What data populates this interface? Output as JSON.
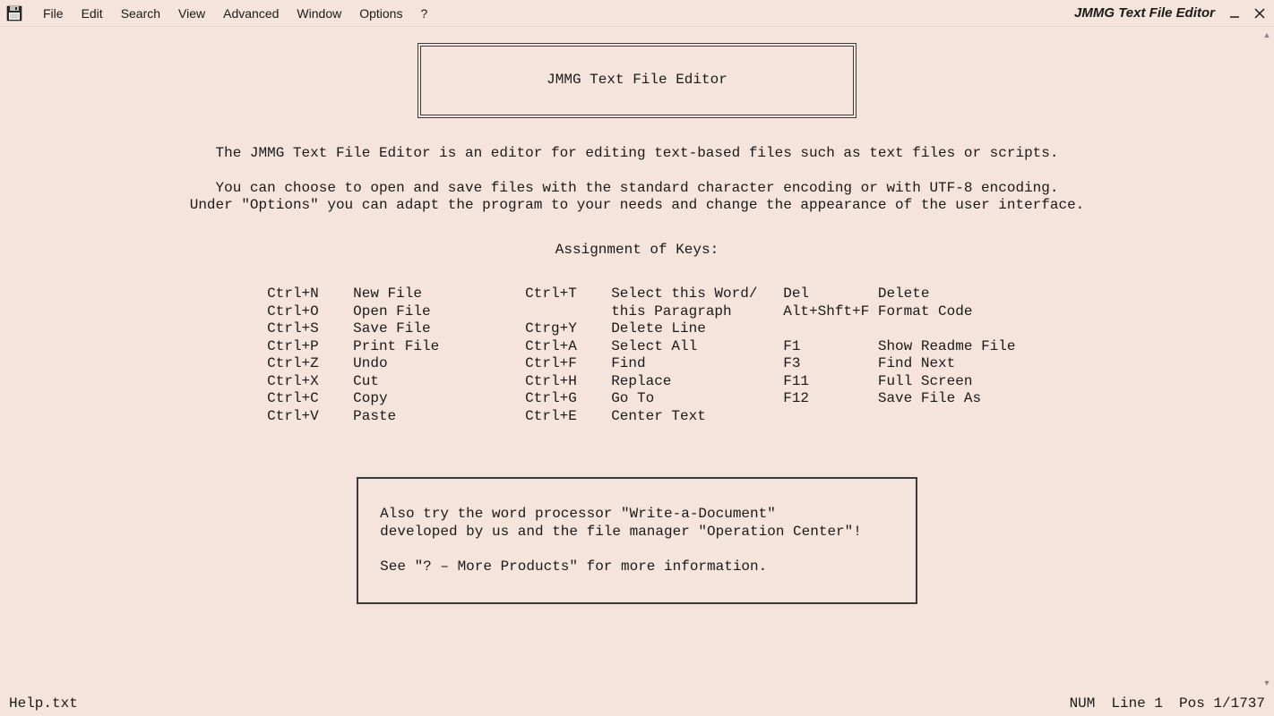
{
  "app": {
    "title": "JMMG Text File Editor"
  },
  "menu": {
    "file": "File",
    "edit": "Edit",
    "search": "Search",
    "view": "View",
    "advanced": "Advanced",
    "window": "Window",
    "options": "Options",
    "help": "?"
  },
  "document": {
    "title_box": "JMMG Text File Editor",
    "intro_line1": "The JMMG Text File Editor is an editor for editing text-based files such as text files or scripts.",
    "intro_line2": "You can choose to open and save files with the standard character encoding or with UTF-8 encoding.",
    "intro_line3": "Under \"Options\" you can adapt the program to your needs and change the appearance of the user interface.",
    "keys_heading": "Assignment of Keys:",
    "keys_block": " Ctrl+N    New File            Ctrl+T    Select this Word/   Del        Delete\n Ctrl+O    Open File                     this Paragraph      Alt+Shft+F Format Code\n Ctrl+S    Save File           Ctrg+Y    Delete Line\n Ctrl+P    Print File          Ctrl+A    Select All          F1         Show Readme File\n Ctrl+Z    Undo                Ctrl+F    Find                F3         Find Next\n Ctrl+X    Cut                 Ctrl+H    Replace             F11        Full Screen\n Ctrl+C    Copy                Ctrl+G    Go To               F12        Save File As\n Ctrl+V    Paste               Ctrl+E    Center Text",
    "promo_line1": "Also try the word processor \"Write-a-Document\"",
    "promo_line2": "developed by us and the file manager \"Operation Center\"!",
    "promo_line3": "",
    "promo_line4": "See \"? – More Products\" for more information."
  },
  "status": {
    "filename": "Help.txt",
    "num": "NUM",
    "line": "Line 1",
    "pos": "Pos 1/1737"
  }
}
